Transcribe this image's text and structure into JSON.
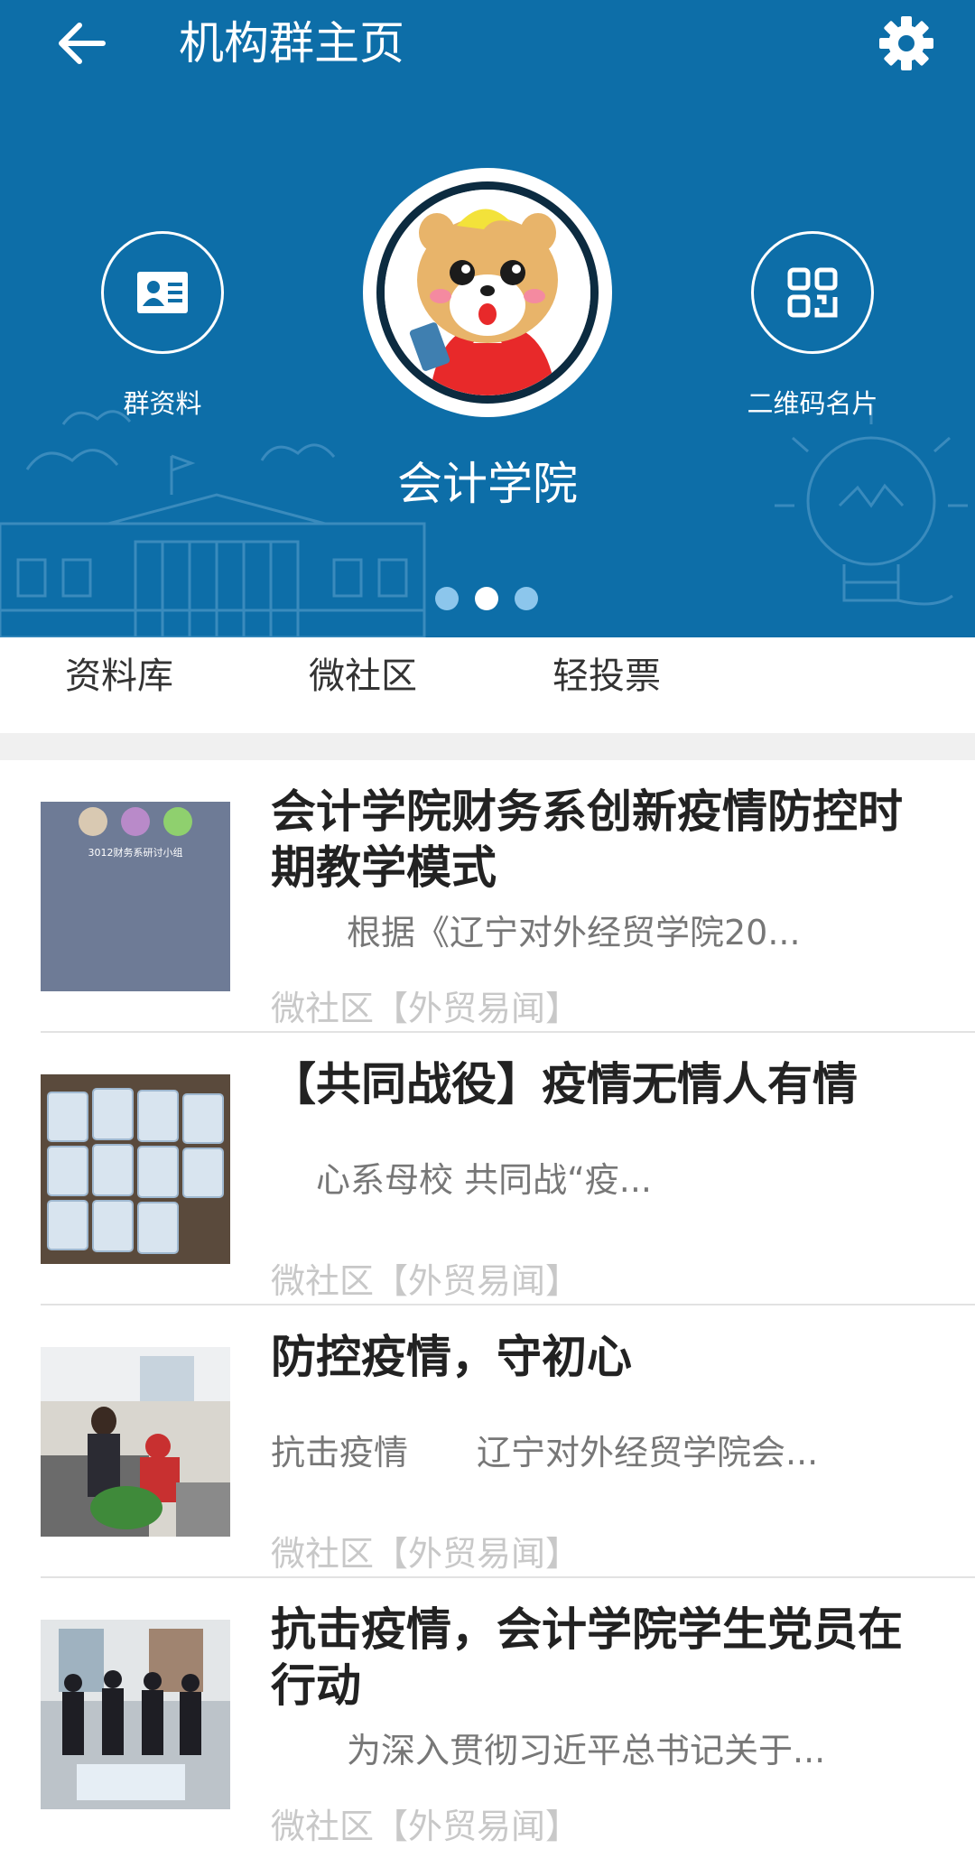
{
  "header": {
    "title": "机构群主页",
    "back_icon": "arrow-left-icon",
    "settings_icon": "gear-icon"
  },
  "profile": {
    "name": "会计学院",
    "left_button": {
      "label": "群资料",
      "icon": "profile-card-icon"
    },
    "right_button": {
      "label": "二维码名片",
      "icon": "qr-code-icon"
    },
    "carousel_dots": 3,
    "active_dot": 1
  },
  "tabs": [
    {
      "label": "资料库"
    },
    {
      "label": "微社区"
    },
    {
      "label": "轻投票"
    }
  ],
  "feed": [
    {
      "title": "会计学院财务系创新疫情防控时期教学模式",
      "summary": "根据《辽宁对外经贸学院20...",
      "source": "微社区【外贸易闻】",
      "thumbnail": "video-call-screenshot",
      "thumb_caption": "3012财务系研讨小组"
    },
    {
      "title": "【共同战役】疫情无情人有情",
      "summary": "心系母校 共同战“疫...",
      "source": "微社区【外贸易闻】",
      "thumbnail": "face-mask-packages"
    },
    {
      "title": "防控疫情，守初心",
      "summary": "抗击疫情　　辽宁对外经贸学院会...",
      "source": "微社区【外贸易闻】",
      "thumbnail": "office-workers-photo"
    },
    {
      "title": "抗击疫情，会计学院学生党员在行动",
      "summary": "为深入贯彻习近平总书记关于...",
      "source": "微社区【外贸易闻】",
      "thumbnail": "volunteers-group-photo"
    }
  ],
  "colors": {
    "banner": "#0d6ea8",
    "text_primary": "#222222",
    "text_secondary": "#777777",
    "text_source": "#c8c8c8"
  }
}
